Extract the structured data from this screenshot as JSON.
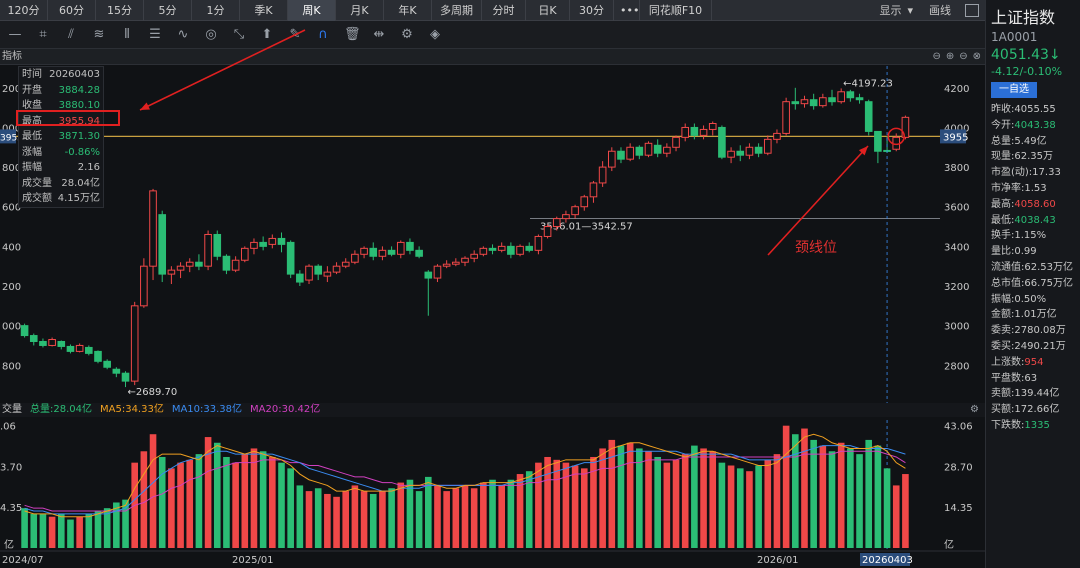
{
  "tabs": [
    "120分",
    "60分",
    "15分",
    "5分",
    "1分",
    "季K",
    "周K",
    "月K",
    "年K",
    "多周期",
    "分时",
    "日K",
    "30分",
    "•••",
    "同花顺F10"
  ],
  "active_tab": "周K",
  "topbar_right": {
    "display": "显示",
    "display_arrow": "▾",
    "draw": "画线"
  },
  "panel_title": "指标",
  "info_box": [
    {
      "k": "时间",
      "v": "20260403",
      "c": ""
    },
    {
      "k": "开盘",
      "v": "3884.28",
      "c": "g"
    },
    {
      "k": "收盘",
      "v": "3880.10",
      "c": "g"
    },
    {
      "k": "最高",
      "v": "3955.94",
      "c": "r"
    },
    {
      "k": "最低",
      "v": "3871.30",
      "c": "g"
    },
    {
      "k": "涨幅",
      "v": "-0.86%",
      "c": "g"
    },
    {
      "k": "振幅",
      "v": "2.16",
      "c": ""
    },
    {
      "k": "成交量",
      "v": "28.04亿",
      "c": ""
    },
    {
      "k": "成交额",
      "v": "4.15万亿",
      "c": ""
    }
  ],
  "annotations": {
    "high_label": "←4197.23",
    "low_label": "←2689.70",
    "neckline_range": "3536.01—3542.57",
    "neckline_text": "颈线位",
    "current_price_tag": "3955",
    "left_price_tag": "3955"
  },
  "price_axis": [
    "4200",
    "4000",
    "3800",
    "3600",
    "3400",
    "3200",
    "3000",
    "2800"
  ],
  "left_axis": [
    "200",
    "000",
    "800",
    "600",
    "400",
    "200",
    "000",
    "800"
  ],
  "volume_axis": [
    "43.06",
    "28.70",
    "14.35",
    "亿"
  ],
  "left_volume_axis": [
    ".06",
    "3.70",
    "4.35",
    "亿"
  ],
  "date_axis": [
    "2024/07",
    "2025/01",
    "2026/01",
    "20260403"
  ],
  "volume_legend": {
    "label": "交量",
    "total": "总量:28.04亿",
    "ma5": "MA5:34.33亿",
    "ma10": "MA10:33.38亿",
    "ma20": "MA20:30.42亿"
  },
  "right_panel": {
    "name": "上证指数",
    "code": "1A0001",
    "price": "4051.43↓",
    "change": "-4.12/-0.10%",
    "watch_btn": "一自选",
    "rows": [
      {
        "k": "昨收:",
        "v": "4055.55",
        "c": ""
      },
      {
        "k": "今开:",
        "v": "4043.38",
        "c": "g"
      },
      {
        "k": "总量:",
        "v": "5.49亿",
        "c": ""
      },
      {
        "k": "现量:",
        "v": "62.35万",
        "c": ""
      },
      {
        "k": "市盈(动):",
        "v": "17.33",
        "c": ""
      },
      {
        "k": "市净率:",
        "v": "1.53",
        "c": ""
      },
      {
        "k": "最高:",
        "v": "4058.60",
        "c": "r"
      },
      {
        "k": "最低:",
        "v": "4038.43",
        "c": "g"
      },
      {
        "k": "换手:",
        "v": "1.15%",
        "c": ""
      },
      {
        "k": "量比:",
        "v": "0.99",
        "c": ""
      },
      {
        "k": "流通值:",
        "v": "62.53万亿",
        "c": ""
      },
      {
        "k": "总市值:",
        "v": "66.75万亿",
        "c": ""
      },
      {
        "k": "振幅:",
        "v": "0.50%",
        "c": ""
      },
      {
        "k": "金额:",
        "v": "1.01万亿",
        "c": ""
      },
      {
        "k": "委卖:",
        "v": "2780.08万",
        "c": ""
      },
      {
        "k": "委买:",
        "v": "2490.21万",
        "c": ""
      },
      {
        "k": "上涨数:",
        "v": "954",
        "c": "r"
      },
      {
        "k": "平盘数:",
        "v": "63",
        "c": ""
      },
      {
        "k": "卖额:",
        "v": "139.44亿",
        "c": ""
      },
      {
        "k": "买额:",
        "v": "172.66亿",
        "c": ""
      },
      {
        "k": "下跌数:",
        "v": "1335",
        "c": "g"
      }
    ]
  },
  "chart_data": {
    "type": "candlestick",
    "ylim": [
      2650,
      4300
    ],
    "candles": [
      [
        3000,
        2950,
        3010,
        2940
      ],
      [
        2950,
        2920,
        2960,
        2900
      ],
      [
        2920,
        2900,
        2935,
        2890
      ],
      [
        2900,
        2930,
        2940,
        2895
      ],
      [
        2920,
        2895,
        2925,
        2880
      ],
      [
        2895,
        2870,
        2905,
        2860
      ],
      [
        2870,
        2900,
        2910,
        2865
      ],
      [
        2890,
        2860,
        2900,
        2850
      ],
      [
        2870,
        2820,
        2875,
        2810
      ],
      [
        2820,
        2790,
        2830,
        2780
      ],
      [
        2780,
        2760,
        2790,
        2740
      ],
      [
        2760,
        2720,
        2770,
        2690
      ],
      [
        2720,
        3100,
        3120,
        2700
      ],
      [
        3100,
        3300,
        3340,
        3090
      ],
      [
        3300,
        3680,
        3690,
        3230
      ],
      [
        3560,
        3260,
        3580,
        3220
      ],
      [
        3260,
        3280,
        3300,
        3210
      ],
      [
        3280,
        3300,
        3320,
        3240
      ],
      [
        3300,
        3320,
        3340,
        3270
      ],
      [
        3320,
        3300,
        3360,
        3280
      ],
      [
        3300,
        3460,
        3480,
        3280
      ],
      [
        3460,
        3350,
        3480,
        3330
      ],
      [
        3350,
        3280,
        3360,
        3260
      ],
      [
        3280,
        3330,
        3350,
        3270
      ],
      [
        3330,
        3390,
        3400,
        3320
      ],
      [
        3390,
        3420,
        3440,
        3360
      ],
      [
        3420,
        3400,
        3450,
        3380
      ],
      [
        3410,
        3440,
        3460,
        3390
      ],
      [
        3440,
        3410,
        3470,
        3370
      ],
      [
        3420,
        3260,
        3430,
        3240
      ],
      [
        3260,
        3220,
        3280,
        3200
      ],
      [
        3230,
        3300,
        3310,
        3210
      ],
      [
        3300,
        3260,
        3310,
        3230
      ],
      [
        3250,
        3270,
        3300,
        3220
      ],
      [
        3270,
        3300,
        3320,
        3260
      ],
      [
        3300,
        3320,
        3340,
        3290
      ],
      [
        3320,
        3360,
        3380,
        3310
      ],
      [
        3360,
        3390,
        3400,
        3340
      ],
      [
        3390,
        3350,
        3420,
        3330
      ],
      [
        3350,
        3380,
        3400,
        3330
      ],
      [
        3380,
        3360,
        3400,
        3350
      ],
      [
        3360,
        3420,
        3430,
        3340
      ],
      [
        3420,
        3380,
        3440,
        3360
      ],
      [
        3380,
        3350,
        3400,
        3340
      ],
      [
        3270,
        3240,
        3280,
        3050
      ],
      [
        3240,
        3300,
        3310,
        3220
      ],
      [
        3300,
        3310,
        3330,
        3290
      ],
      [
        3310,
        3320,
        3340,
        3300
      ],
      [
        3320,
        3340,
        3350,
        3300
      ],
      [
        3340,
        3360,
        3380,
        3320
      ],
      [
        3360,
        3390,
        3400,
        3350
      ],
      [
        3390,
        3380,
        3410,
        3360
      ],
      [
        3380,
        3400,
        3420,
        3370
      ],
      [
        3400,
        3360,
        3420,
        3340
      ],
      [
        3360,
        3400,
        3410,
        3350
      ],
      [
        3400,
        3380,
        3420,
        3370
      ],
      [
        3380,
        3450,
        3460,
        3360
      ],
      [
        3450,
        3500,
        3510,
        3440
      ],
      [
        3500,
        3540,
        3550,
        3480
      ],
      [
        3540,
        3560,
        3580,
        3520
      ],
      [
        3560,
        3600,
        3610,
        3540
      ],
      [
        3600,
        3650,
        3660,
        3580
      ],
      [
        3650,
        3720,
        3730,
        3620
      ],
      [
        3720,
        3800,
        3830,
        3700
      ],
      [
        3800,
        3880,
        3900,
        3780
      ],
      [
        3880,
        3840,
        3900,
        3820
      ],
      [
        3840,
        3900,
        3920,
        3830
      ],
      [
        3900,
        3860,
        3910,
        3840
      ],
      [
        3860,
        3920,
        3930,
        3850
      ],
      [
        3910,
        3870,
        3940,
        3850
      ],
      [
        3870,
        3900,
        3920,
        3850
      ],
      [
        3900,
        3950,
        3960,
        3880
      ],
      [
        3950,
        4000,
        4020,
        3930
      ],
      [
        4000,
        3960,
        4020,
        3940
      ],
      [
        3960,
        3990,
        4010,
        3940
      ],
      [
        3990,
        4020,
        4030,
        3960
      ],
      [
        4000,
        3850,
        4010,
        3840
      ],
      [
        3850,
        3880,
        3900,
        3820
      ],
      [
        3880,
        3860,
        3910,
        3830
      ],
      [
        3860,
        3900,
        3920,
        3840
      ],
      [
        3900,
        3870,
        3920,
        3850
      ],
      [
        3870,
        3940,
        3960,
        3860
      ],
      [
        3940,
        3970,
        3990,
        3920
      ],
      [
        3970,
        4130,
        4150,
        3960
      ],
      [
        4130,
        4120,
        4200,
        4090
      ],
      [
        4120,
        4140,
        4160,
        4100
      ],
      [
        4140,
        4110,
        4170,
        4090
      ],
      [
        4110,
        4150,
        4170,
        4100
      ],
      [
        4150,
        4130,
        4190,
        4110
      ],
      [
        4130,
        4180,
        4197,
        4120
      ],
      [
        4180,
        4150,
        4190,
        4130
      ],
      [
        4150,
        4140,
        4170,
        4120
      ],
      [
        4130,
        3980,
        4140,
        3960
      ],
      [
        3980,
        3880,
        3960,
        3820
      ],
      [
        3884,
        3880,
        3956,
        3871
      ],
      [
        3890,
        3950,
        3970,
        3880
      ],
      [
        3950,
        4051,
        4060,
        3940
      ]
    ],
    "volume": [
      14,
      12,
      12,
      11,
      12,
      10,
      11,
      12,
      13,
      14,
      16,
      17,
      30,
      34,
      40,
      32,
      28,
      30,
      31,
      33,
      39,
      37,
      32,
      30,
      33,
      35,
      34,
      32,
      30,
      28,
      22,
      20,
      21,
      19,
      18,
      20,
      22,
      20,
      19,
      20,
      21,
      23,
      24,
      20,
      25,
      22,
      20,
      21,
      22,
      21,
      23,
      24,
      22,
      24,
      26,
      27,
      30,
      32,
      31,
      30,
      29,
      28,
      32,
      35,
      38,
      36,
      37,
      35,
      34,
      32,
      30,
      31,
      33,
      36,
      35,
      34,
      30,
      29,
      28,
      27,
      29,
      31,
      33,
      43,
      40,
      42,
      38,
      36,
      34,
      37,
      35,
      33,
      38,
      36,
      28,
      22,
      26
    ],
    "ma5": [
      13,
      12,
      12,
      12,
      11,
      11,
      11,
      11,
      12,
      13,
      14,
      15,
      21,
      26,
      31,
      33,
      33,
      33,
      32,
      31,
      34,
      36,
      35,
      34,
      33,
      34,
      33,
      32,
      31,
      29,
      26,
      24,
      23,
      22,
      20,
      20,
      21,
      20,
      20,
      20,
      20,
      21,
      22,
      22,
      23,
      22,
      21,
      21,
      22,
      22,
      23,
      23,
      23,
      23,
      24,
      25,
      27,
      29,
      30,
      31,
      31,
      31,
      31,
      33,
      35,
      36,
      37,
      37,
      36,
      35,
      34,
      33,
      32,
      33,
      34,
      34,
      33,
      32,
      31,
      30,
      29,
      29,
      30,
      33,
      36,
      39,
      40,
      39,
      37,
      36,
      35,
      35,
      35,
      36,
      34,
      30,
      28
    ],
    "ma10": [
      14,
      13,
      13,
      12,
      12,
      12,
      12,
      12,
      12,
      12,
      13,
      14,
      17,
      20,
      23,
      26,
      28,
      30,
      31,
      32,
      33,
      34,
      34,
      33,
      33,
      33,
      33,
      33,
      32,
      31,
      30,
      28,
      27,
      26,
      25,
      24,
      23,
      22,
      21,
      20,
      20,
      21,
      21,
      21,
      22,
      22,
      22,
      22,
      22,
      22,
      22,
      22,
      22,
      23,
      23,
      24,
      25,
      26,
      27,
      28,
      29,
      30,
      30,
      31,
      32,
      33,
      34,
      34,
      34,
      34,
      34,
      34,
      33,
      33,
      33,
      33,
      33,
      33,
      32,
      31,
      31,
      31,
      31,
      32,
      33,
      34,
      35,
      36,
      36,
      36,
      36,
      35,
      35,
      35,
      35,
      34,
      33
    ],
    "ma20": [
      15,
      14,
      14,
      13,
      13,
      13,
      13,
      13,
      13,
      13,
      13,
      13,
      15,
      16,
      18,
      19,
      21,
      22,
      24,
      25,
      27,
      28,
      29,
      30,
      30,
      30,
      31,
      31,
      31,
      30,
      30,
      29,
      29,
      28,
      27,
      26,
      25,
      25,
      24,
      23,
      23,
      22,
      22,
      22,
      22,
      22,
      22,
      22,
      22,
      22,
      22,
      22,
      22,
      22,
      22,
      23,
      23,
      24,
      24,
      25,
      26,
      26,
      27,
      28,
      28,
      29,
      30,
      30,
      31,
      31,
      31,
      31,
      32,
      32,
      32,
      32,
      32,
      32,
      32,
      32,
      32,
      32,
      32,
      32,
      32,
      33,
      33,
      33,
      33,
      34,
      34,
      34,
      34,
      34,
      33,
      32,
      30
    ],
    "vol_ylim": [
      0,
      45
    ]
  },
  "colors": {
    "up": "#f04848",
    "down": "#2bbd75",
    "ma5": "#f0a020",
    "ma10": "#3a8bf0",
    "ma20": "#d040c0",
    "neck": "#c9a040",
    "arrow": "#e02020"
  }
}
